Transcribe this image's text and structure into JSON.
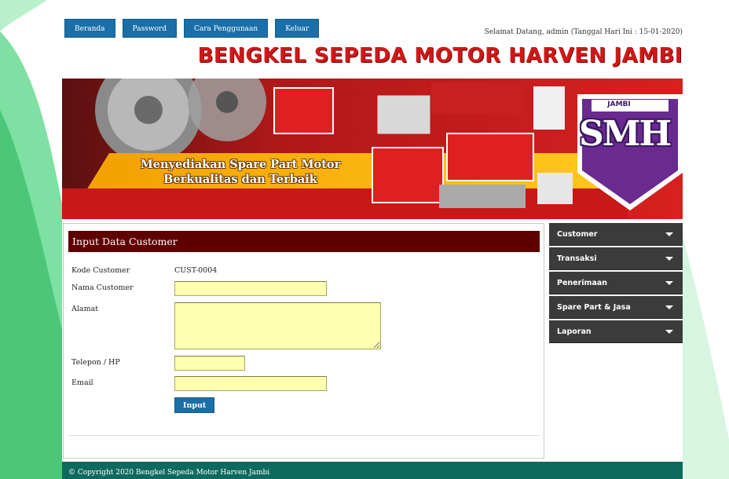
{
  "nav": {
    "items": [
      "Beranda",
      "Password",
      "Cara Penggunaan",
      "Keluar"
    ]
  },
  "header": {
    "welcome": "Selamat Datang, admin (Tanggal Hari Ini : 15-01-2020)",
    "site_title": "BENGKEL SEPEDA MOTOR HARVEN JAMBI"
  },
  "banner": {
    "tagline_line1": "Menyediakan Spare Part Motor",
    "tagline_line2": "Berkualitas dan Terbaik",
    "logo_top": "JAMBI",
    "logo_main": "SMH"
  },
  "form": {
    "title": "Input Data Customer",
    "kode_label": "Kode Customer",
    "kode_value": "CUST-0004",
    "nama_label": "Nama Customer",
    "nama_value": "",
    "alamat_label": "Alamat",
    "alamat_value": "",
    "telepon_label": "Telepon / HP",
    "telepon_value": "",
    "email_label": "Email",
    "email_value": "",
    "submit_label": "Input"
  },
  "sidebar": {
    "items": [
      "Customer",
      "Transaksi",
      "Penerimaan",
      "Spare Part & Jasa",
      "Laporan"
    ]
  },
  "footer": {
    "copyright": "© Copyright 2020 Bengkel Sepeda Motor Harven Jambi"
  },
  "colors": {
    "nav_button": "#1a6fa8",
    "title_red": "#d01818",
    "panel_header": "#5e0000",
    "sidebar_bg": "#3b3b3b",
    "input_bg": "#ffffb0",
    "footer_bg": "#0e6a5e",
    "wave_green": "#5fd08a"
  }
}
